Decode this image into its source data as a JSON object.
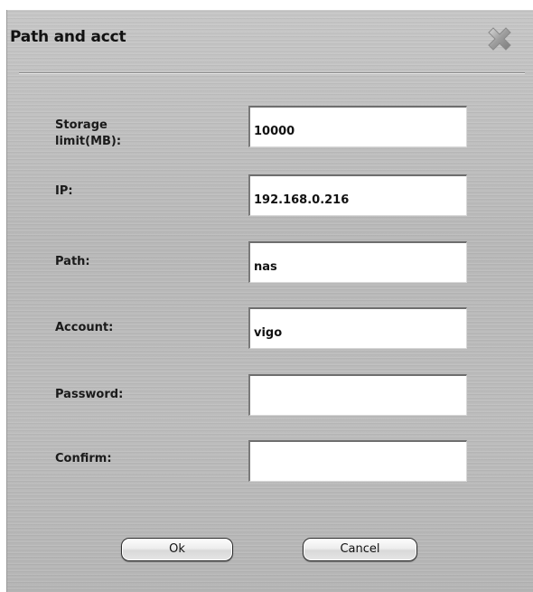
{
  "dialog": {
    "title": "Path and acct",
    "close_icon": "close-x-icon"
  },
  "fields": [
    {
      "label": "Storage\nlimit(MB):",
      "value": "10000",
      "placeholder": ""
    },
    {
      "label": "IP:",
      "value": "192.168.0.216",
      "placeholder": ""
    },
    {
      "label": "Path:",
      "value": "nas",
      "placeholder": ""
    },
    {
      "label": "Account:",
      "value": "vigo",
      "placeholder": ""
    },
    {
      "label": "Password:",
      "value": "",
      "placeholder": ""
    },
    {
      "label": "Confirm:",
      "value": "",
      "placeholder": ""
    }
  ],
  "buttons": {
    "ok_label": "Ok",
    "cancel_label": "Cancel"
  }
}
